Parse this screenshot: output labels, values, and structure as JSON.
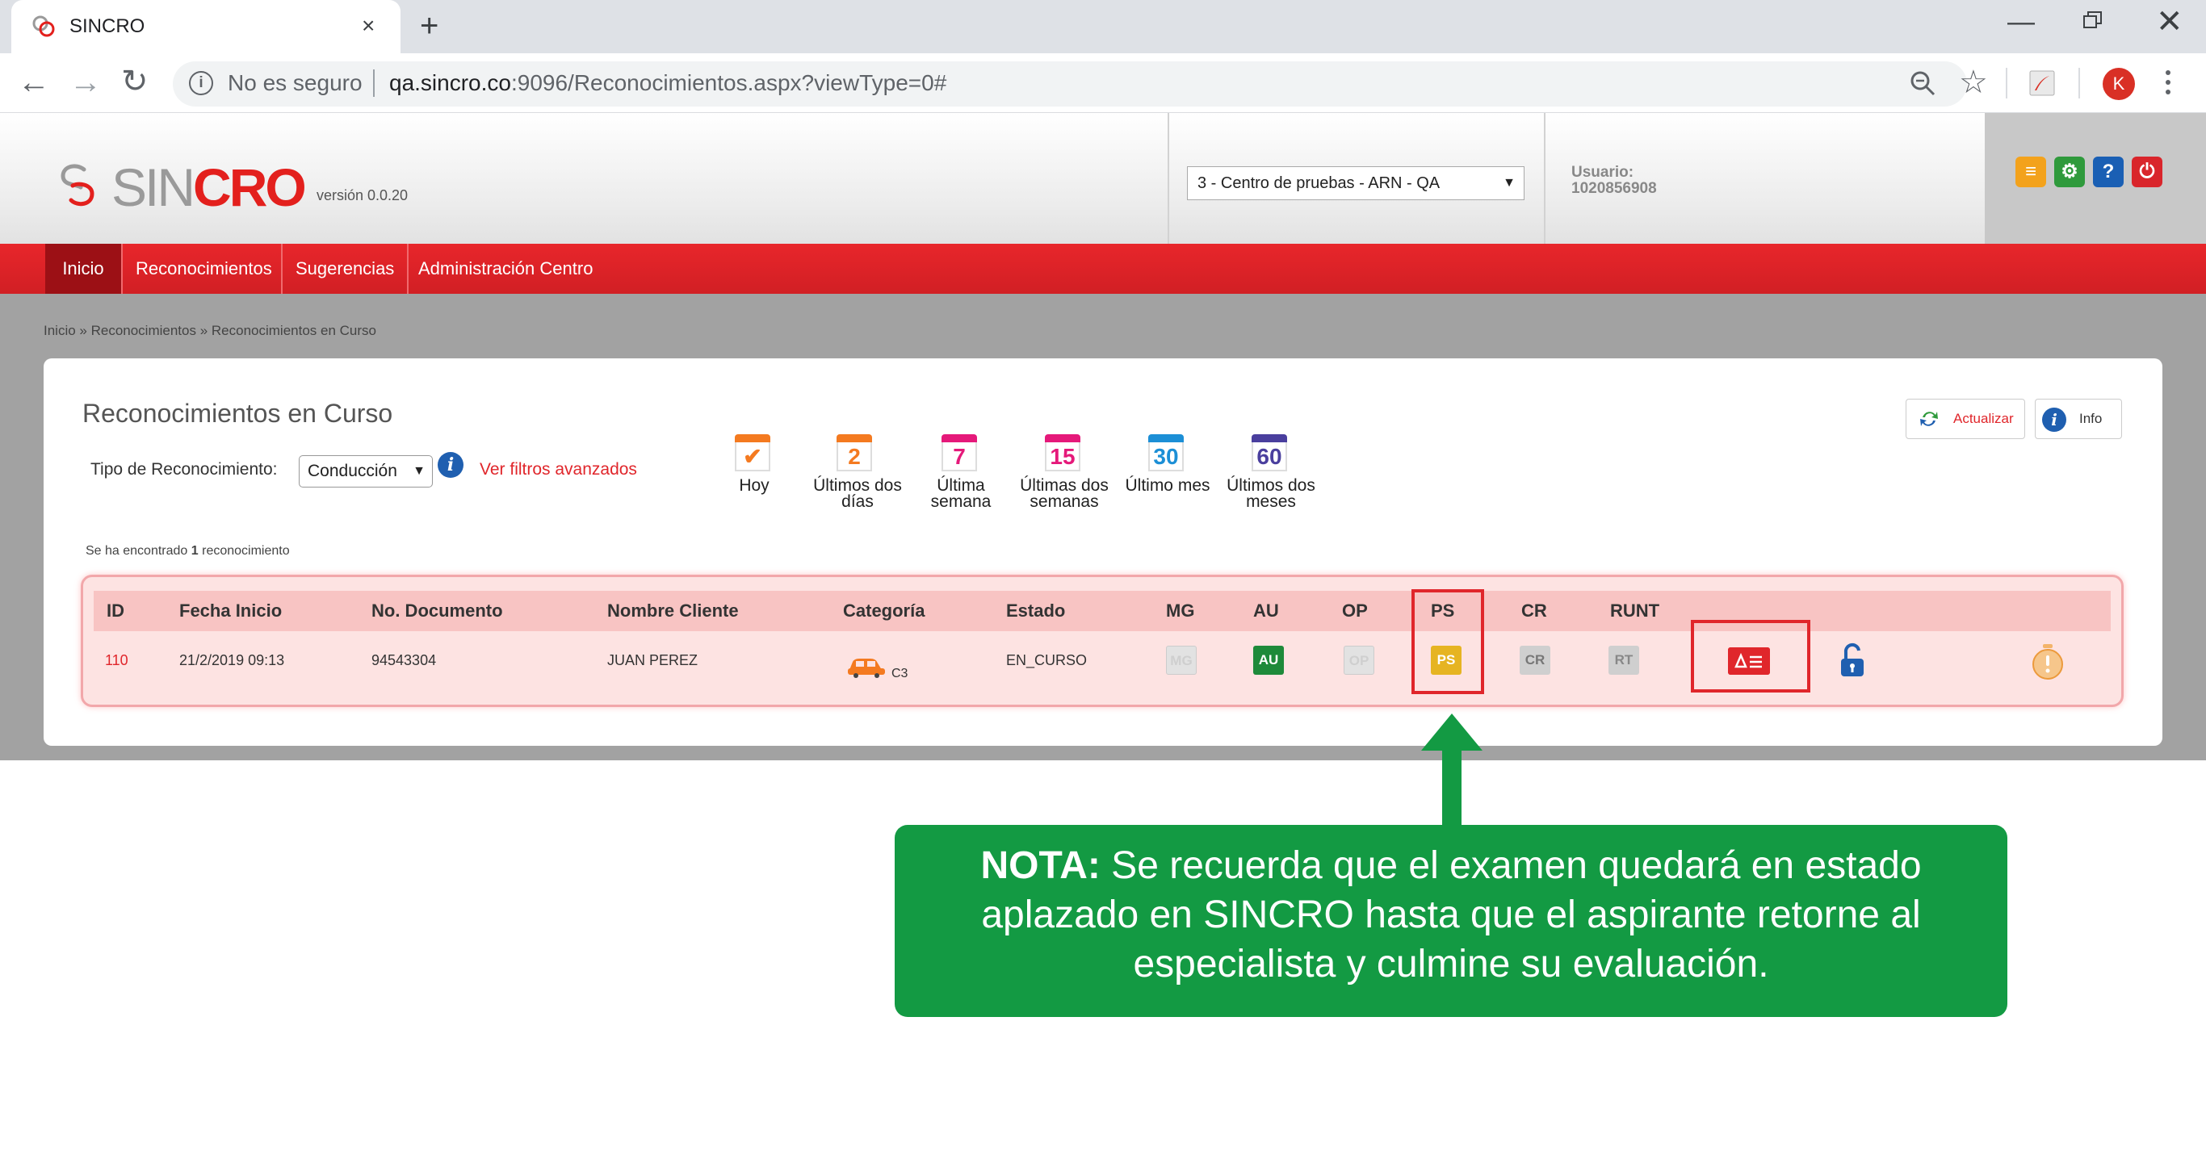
{
  "browser": {
    "tab_title": "SINCRO",
    "tab_close": "×",
    "new_tab": "+",
    "security_label": "No es seguro",
    "url_host": "qa.sincro.co",
    "url_path": ":9096/Reconocimientos.aspx?viewType=0#",
    "profile_initial": "K"
  },
  "header": {
    "logo_sin": "SIN",
    "logo_cro": "CRO",
    "version": "versión 0.0.20",
    "center_select_value": "3 - Centro de pruebas - ARN - QA",
    "user_label": "Usuario:",
    "user_id": "1020856908"
  },
  "nav": {
    "items": [
      "Inicio",
      "Reconocimientos",
      "Sugerencias",
      "Administración Centro"
    ]
  },
  "breadcrumb": "Inicio » Reconocimientos » Reconocimientos en Curso",
  "panel": {
    "title": "Reconocimientos en Curso",
    "tipo_label": "Tipo de Reconocimiento:",
    "tipo_value": "Conducción",
    "filtros_link": "Ver filtros avanzados",
    "actualizar": "Actualizar",
    "info": "Info",
    "found_prefix": "Se ha encontrado ",
    "found_count": "1",
    "found_suffix": " reconocimiento"
  },
  "date_filters": [
    {
      "number": "✔",
      "label": "Hoy",
      "color": "#f47a20"
    },
    {
      "number": "2",
      "label": "Últimos dos días",
      "color": "#f47a20"
    },
    {
      "number": "7",
      "label": "Última semana",
      "color": "#e5197a"
    },
    {
      "number": "15",
      "label": "Últimas dos semanas",
      "color": "#e5197a"
    },
    {
      "number": "30",
      "label": "Último mes",
      "color": "#1c8fd6"
    },
    {
      "number": "60",
      "label": "Últimos dos meses",
      "color": "#4a3f9e"
    }
  ],
  "table": {
    "headers": [
      "ID",
      "Fecha Inicio",
      "No. Documento",
      "Nombre Cliente",
      "Categoría",
      "Estado",
      "MG",
      "AU",
      "OP",
      "PS",
      "CR",
      "RUNT"
    ],
    "row": {
      "id": "110",
      "fecha": "21/2/2019 09:13",
      "documento": "94543304",
      "cliente": "JUAN PEREZ",
      "categoria": "C3",
      "estado": "EN_CURSO",
      "mg": "MG",
      "au": "AU",
      "op": "OP",
      "ps": "PS",
      "cr": "CR",
      "rt": "RT"
    }
  },
  "note": {
    "bold": "NOTA:",
    "text": " Se recuerda que el examen quedará en estado aplazado en SINCRO hasta que el aspirante retorne al especialista y culmine su evaluación."
  },
  "colors": {
    "brand_red": "#e3201d",
    "note_green": "#139a43"
  }
}
